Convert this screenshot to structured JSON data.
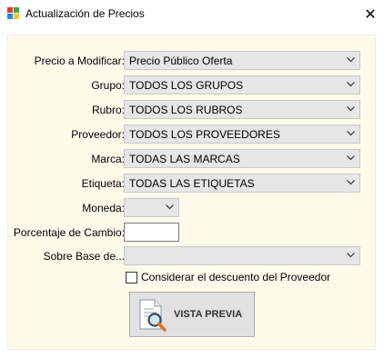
{
  "window": {
    "title": "Actualización de Precios",
    "close_glyph": "✕"
  },
  "form": {
    "fields": [
      {
        "label": "Precio a Modificar:",
        "value": "Precio Público Oferta"
      },
      {
        "label": "Grupo:",
        "value": "TODOS LOS GRUPOS"
      },
      {
        "label": "Rubro:",
        "value": "TODOS LOS RUBROS"
      },
      {
        "label": "Proveedor:",
        "value": "TODOS LOS PROVEEDORES"
      },
      {
        "label": "Marca:",
        "value": "TODAS LAS MARCAS"
      },
      {
        "label": "Etiqueta:",
        "value": "TODAS LAS ETIQUETAS"
      }
    ],
    "moneda": {
      "label": "Moneda:",
      "value": ""
    },
    "porcentaje": {
      "label": "Porcentaje de Cambio:",
      "value": ""
    },
    "sobre_base": {
      "label": "Sobre Base de...",
      "value": ""
    },
    "descuento_checkbox": {
      "label": "Considerar el descuento del Proveedor",
      "checked": false
    },
    "preview_button": {
      "label": "VISTA PREVIA"
    }
  },
  "colors": {
    "panel_background": "#fffbeb",
    "combo_background": "#e6e6e6",
    "button_background": "#e1e1e1",
    "logo": [
      "#e53935",
      "#43a047",
      "#1e88e5",
      "#fbc02d"
    ]
  },
  "icons": {
    "app": "app-logo-icon",
    "close": "close-icon",
    "dropdown": "chevron-down-icon",
    "preview": "document-magnifier-icon"
  }
}
